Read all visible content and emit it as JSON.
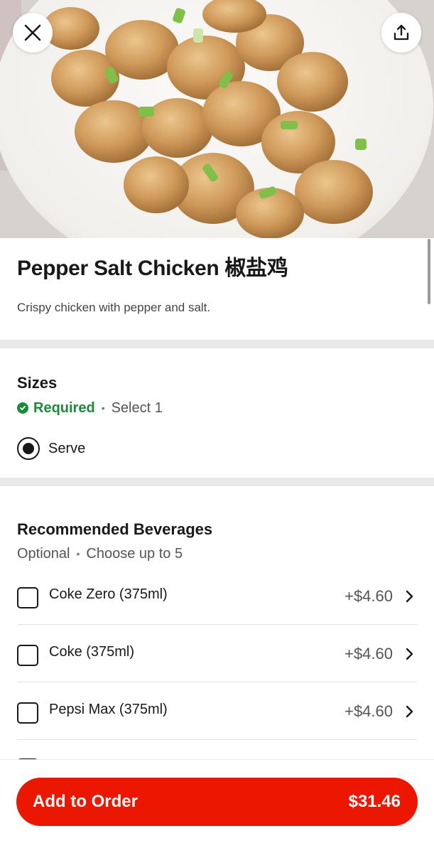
{
  "item": {
    "title": "Pepper Salt Chicken 椒盐鸡",
    "description": "Crispy chicken with pepper and salt."
  },
  "header_icons": {
    "close": "close-icon",
    "share": "share-icon"
  },
  "sizes": {
    "title": "Sizes",
    "required_label": "Required",
    "rule": "Select 1",
    "options": [
      {
        "label": "Serve",
        "selected": true
      }
    ]
  },
  "beverages": {
    "title": "Recommended Beverages",
    "optional_label": "Optional",
    "rule": "Choose up to 5",
    "items": [
      {
        "label": "Coke Zero (375ml)",
        "price": "+$4.60"
      },
      {
        "label": "Coke (375ml)",
        "price": "+$4.60"
      },
      {
        "label": "Pepsi Max (375ml)",
        "price": "+$4.60"
      }
    ]
  },
  "order": {
    "button_label": "Add to Order",
    "total": "$31.46"
  },
  "colors": {
    "brand_red": "#eb1700",
    "required_green": "#1a8a3a",
    "text_primary": "#191919"
  }
}
